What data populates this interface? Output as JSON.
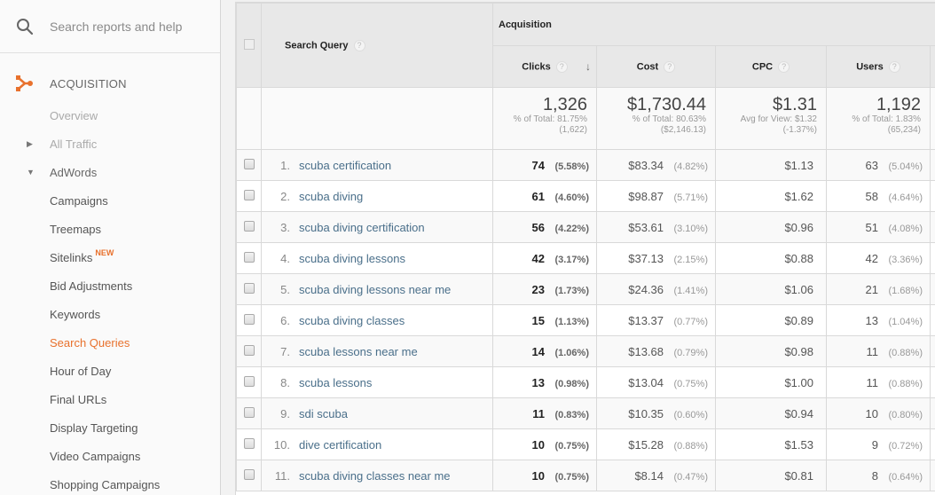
{
  "sidebar": {
    "search_placeholder": "Search reports and help",
    "section": {
      "label": "ACQUISITION",
      "icon": "acquisition-icon",
      "accent": "#e8712d"
    },
    "items": [
      {
        "label": "Overview",
        "state": "dim"
      },
      {
        "label": "All Traffic",
        "state": "dim",
        "arrow": "▶"
      },
      {
        "label": "AdWords",
        "state": "expanded",
        "arrow": "▼"
      },
      {
        "label": "Campaigns",
        "state": "child"
      },
      {
        "label": "Treemaps",
        "state": "child"
      },
      {
        "label": "Sitelinks",
        "state": "child",
        "badge": "NEW"
      },
      {
        "label": "Bid Adjustments",
        "state": "child"
      },
      {
        "label": "Keywords",
        "state": "child"
      },
      {
        "label": "Search Queries",
        "state": "active"
      },
      {
        "label": "Hour of Day",
        "state": "child"
      },
      {
        "label": "Final URLs",
        "state": "child"
      },
      {
        "label": "Display Targeting",
        "state": "child"
      },
      {
        "label": "Video Campaigns",
        "state": "child"
      },
      {
        "label": "Shopping Campaigns",
        "state": "child"
      }
    ]
  },
  "table": {
    "group_header": "Acquisition",
    "dimension_header": "Search Query",
    "help_glyph": "?",
    "sort_glyph": "↓",
    "columns": {
      "clicks": "Clicks",
      "cost": "Cost",
      "cpc": "CPC",
      "users": "Users"
    },
    "totals": {
      "clicks": {
        "value": "1,326",
        "line1": "% of Total: 81.75%",
        "line2": "(1,622)"
      },
      "cost": {
        "value": "$1,730.44",
        "line1": "% of Total: 80.63%",
        "line2": "($2,146.13)"
      },
      "cpc": {
        "value": "$1.31",
        "line1": "Avg for View: $1.32",
        "line2": "(-1.37%)"
      },
      "users": {
        "value": "1,192",
        "line1": "% of Total: 1.83%",
        "line2": "(65,234)"
      }
    },
    "rows": [
      {
        "num": "1.",
        "query": "scuba certification",
        "clicks": "74",
        "clicks_pct": "(5.58%)",
        "cost": "$83.34",
        "cost_pct": "(4.82%)",
        "cpc": "$1.13",
        "users": "63",
        "users_pct": "(5.04%)"
      },
      {
        "num": "2.",
        "query": "scuba diving",
        "clicks": "61",
        "clicks_pct": "(4.60%)",
        "cost": "$98.87",
        "cost_pct": "(5.71%)",
        "cpc": "$1.62",
        "users": "58",
        "users_pct": "(4.64%)"
      },
      {
        "num": "3.",
        "query": "scuba diving certification",
        "clicks": "56",
        "clicks_pct": "(4.22%)",
        "cost": "$53.61",
        "cost_pct": "(3.10%)",
        "cpc": "$0.96",
        "users": "51",
        "users_pct": "(4.08%)"
      },
      {
        "num": "4.",
        "query": "scuba diving lessons",
        "clicks": "42",
        "clicks_pct": "(3.17%)",
        "cost": "$37.13",
        "cost_pct": "(2.15%)",
        "cpc": "$0.88",
        "users": "42",
        "users_pct": "(3.36%)"
      },
      {
        "num": "5.",
        "query": "scuba diving lessons near me",
        "clicks": "23",
        "clicks_pct": "(1.73%)",
        "cost": "$24.36",
        "cost_pct": "(1.41%)",
        "cpc": "$1.06",
        "users": "21",
        "users_pct": "(1.68%)"
      },
      {
        "num": "6.",
        "query": "scuba diving classes",
        "clicks": "15",
        "clicks_pct": "(1.13%)",
        "cost": "$13.37",
        "cost_pct": "(0.77%)",
        "cpc": "$0.89",
        "users": "13",
        "users_pct": "(1.04%)"
      },
      {
        "num": "7.",
        "query": "scuba lessons near me",
        "clicks": "14",
        "clicks_pct": "(1.06%)",
        "cost": "$13.68",
        "cost_pct": "(0.79%)",
        "cpc": "$0.98",
        "users": "11",
        "users_pct": "(0.88%)"
      },
      {
        "num": "8.",
        "query": "scuba lessons",
        "clicks": "13",
        "clicks_pct": "(0.98%)",
        "cost": "$13.04",
        "cost_pct": "(0.75%)",
        "cpc": "$1.00",
        "users": "11",
        "users_pct": "(0.88%)"
      },
      {
        "num": "9.",
        "query": "sdi scuba",
        "clicks": "11",
        "clicks_pct": "(0.83%)",
        "cost": "$10.35",
        "cost_pct": "(0.60%)",
        "cpc": "$0.94",
        "users": "10",
        "users_pct": "(0.80%)"
      },
      {
        "num": "10.",
        "query": "dive certification",
        "clicks": "10",
        "clicks_pct": "(0.75%)",
        "cost": "$15.28",
        "cost_pct": "(0.88%)",
        "cpc": "$1.53",
        "users": "9",
        "users_pct": "(0.72%)"
      },
      {
        "num": "11.",
        "query": "scuba diving classes near me",
        "clicks": "10",
        "clicks_pct": "(0.75%)",
        "cost": "$8.14",
        "cost_pct": "(0.47%)",
        "cpc": "$0.81",
        "users": "8",
        "users_pct": "(0.64%)"
      }
    ]
  }
}
